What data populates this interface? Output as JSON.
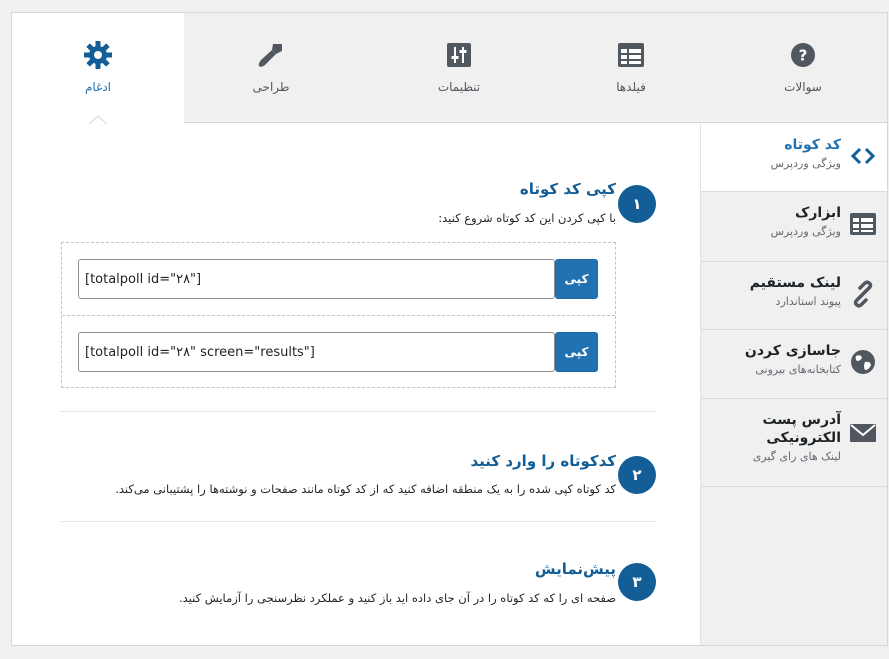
{
  "tabs": [
    {
      "label": "سوالات",
      "icon": "question-circle-icon"
    },
    {
      "label": "فیلدها",
      "icon": "fields-table-icon"
    },
    {
      "label": "تنظیمات",
      "icon": "sliders-icon"
    },
    {
      "label": "طراحی",
      "icon": "paint-brush-icon"
    },
    {
      "label": "ادغام",
      "icon": "gear-icon"
    }
  ],
  "active_tab": "ادغام",
  "sidebar": {
    "items": [
      {
        "title": "کد کوتاه",
        "subtitle": "ویژگی وردپرس",
        "icon": "code-brackets-icon"
      },
      {
        "title": "ابزارک",
        "subtitle": "ویژگی وردپرس",
        "icon": "widget-table-icon"
      },
      {
        "title": "لینک مستقیم",
        "subtitle": "پیوند استاندارد",
        "icon": "link-icon"
      },
      {
        "title": "جاسازی کردن",
        "subtitle": "کتابخانه‌های بیرونی",
        "icon": "globe-icon"
      },
      {
        "title": "آدرس پست الکترونیکی",
        "subtitle": "لینک های رای گیری",
        "icon": "envelope-icon"
      }
    ]
  },
  "steps": [
    {
      "number": "۱",
      "title": "کپی کد کوتاه",
      "description": "با کپی کردن این کد کوتاه شروع کنید:",
      "codes": [
        {
          "value": "[totalpoll id=\"۲۸\"]",
          "button": "کپی"
        },
        {
          "value": "[totalpoll id=\"۲۸\" screen=\"results\"]",
          "button": "کپی"
        }
      ]
    },
    {
      "number": "۲",
      "title": "کدکوتاه را وارد کنید",
      "description": "کد کوتاه کپی شده را به یک منطقه اضافه کنید که از کد کوتاه مانند صفحات و نوشته‌ها را پشتیبانی می‌کند."
    },
    {
      "number": "۳",
      "title": "پیش‌نمایش",
      "description": "صفحه ای را که کد کوتاه را در آن جای داده اید باز کنید و عملکرد نظرسنجی را آزمایش کنید."
    }
  ],
  "colors": {
    "accent": "#2271b1",
    "dark_accent": "#135e96",
    "icon_gray": "#50575e"
  }
}
